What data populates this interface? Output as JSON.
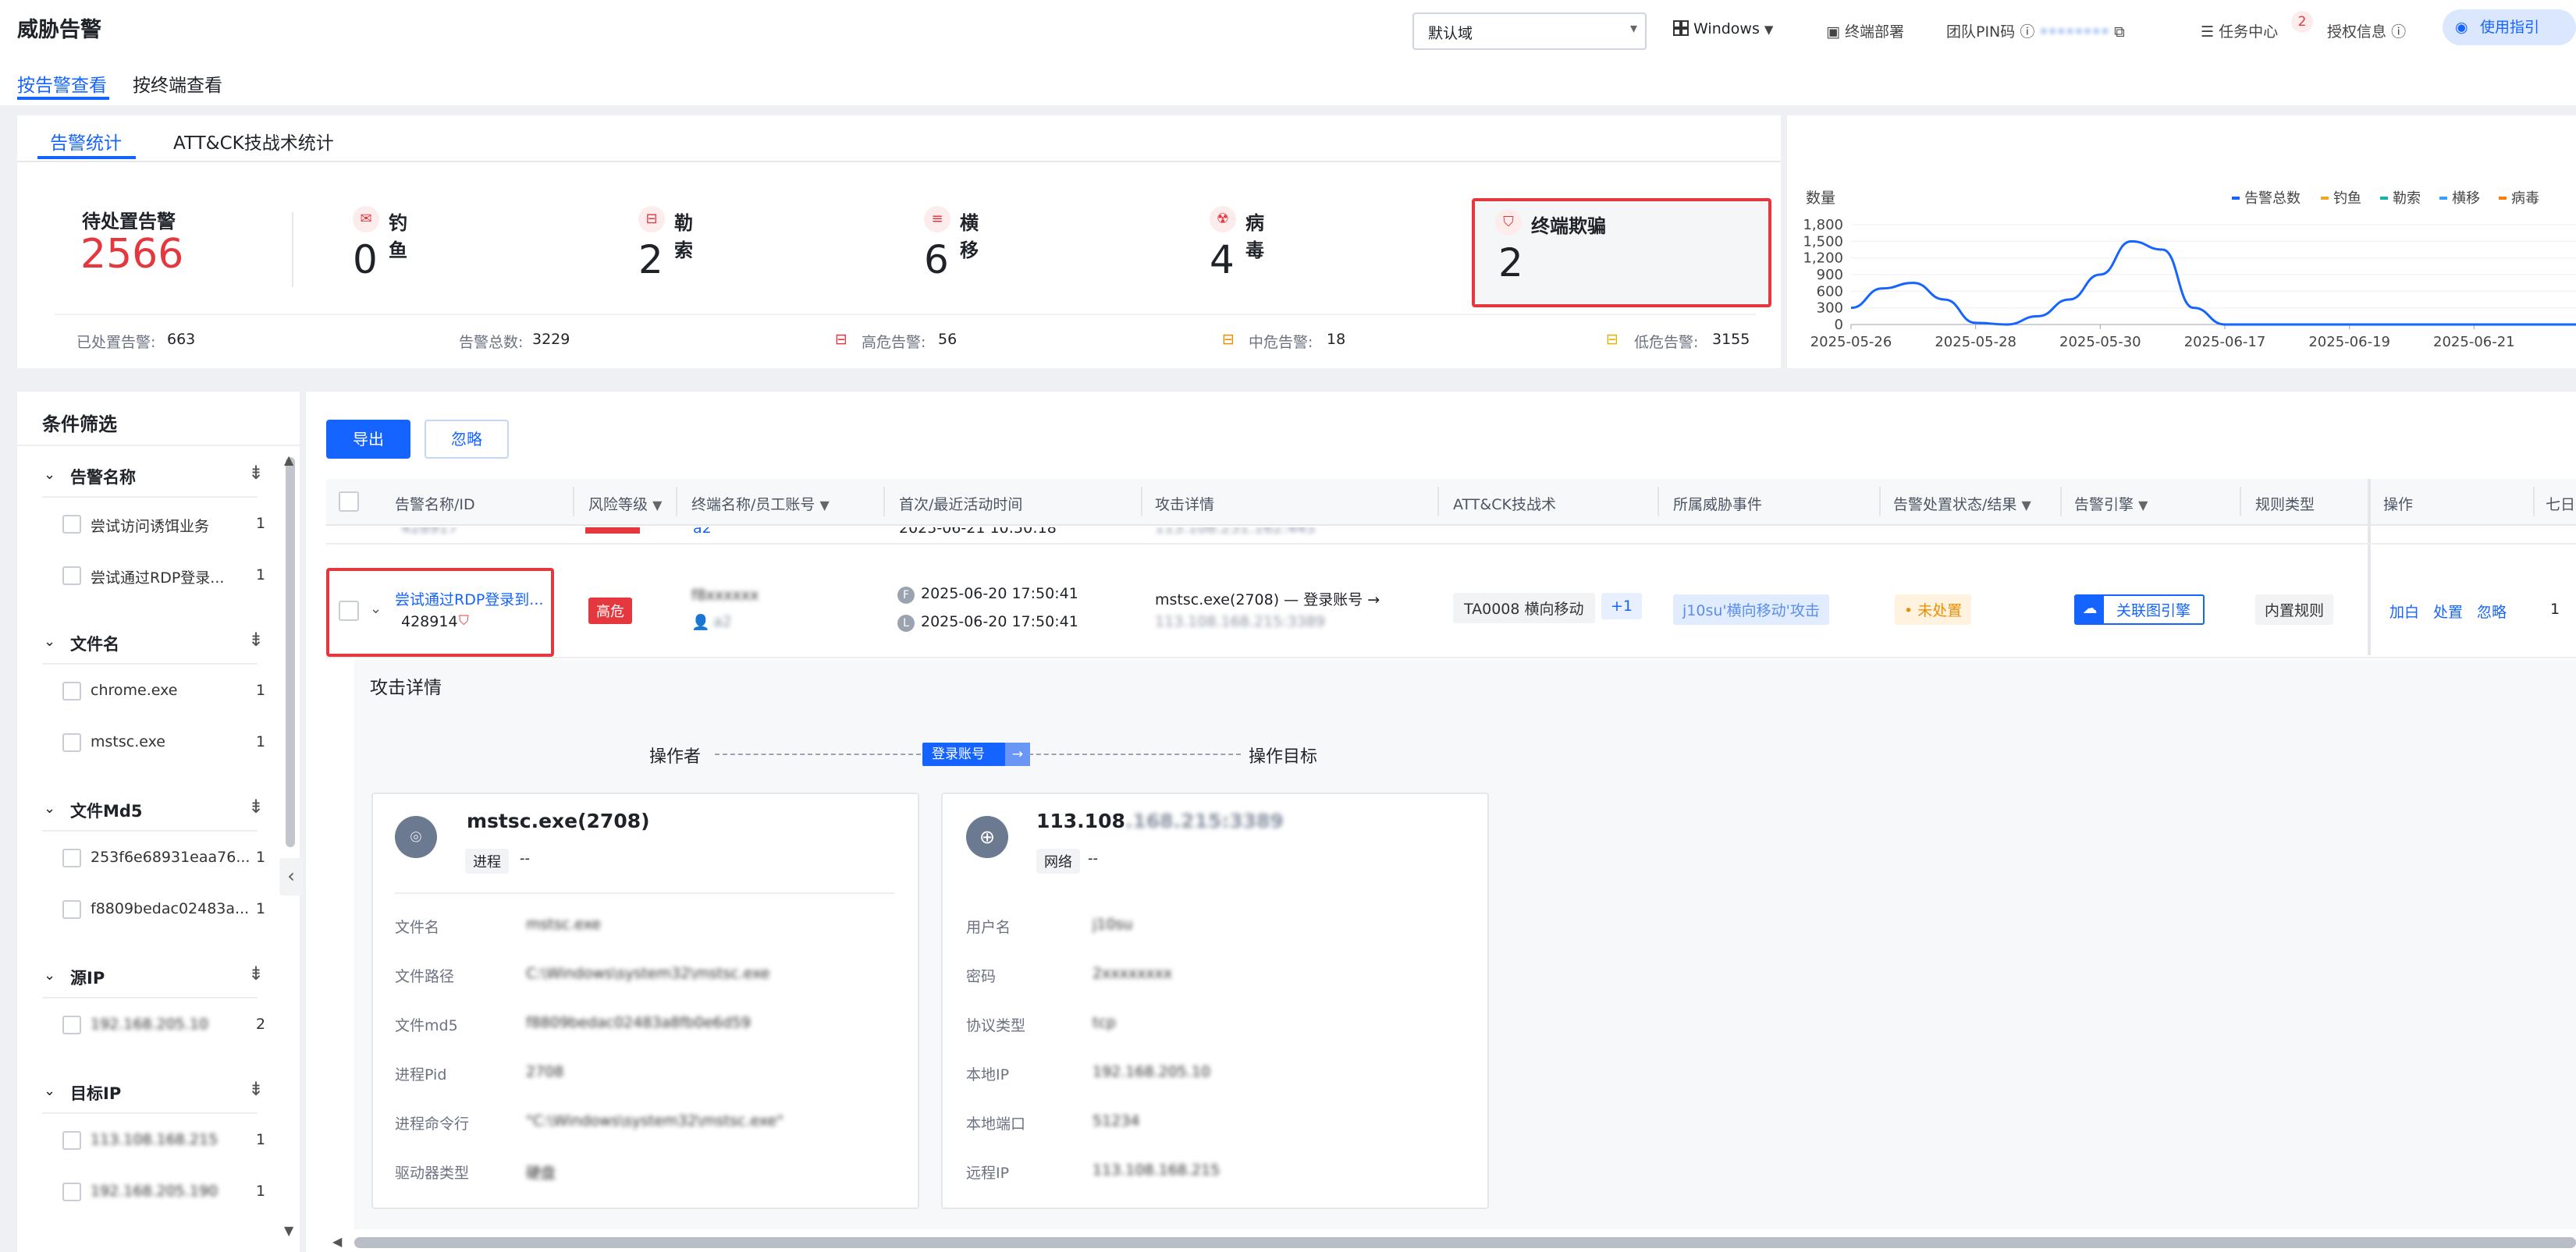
{
  "header": {
    "title": "威胁告警",
    "tabs": [
      "按告警查看",
      "按终端查看"
    ],
    "domain_select": "默认域",
    "os_select": "Windows",
    "deploy": "终端部署",
    "pin_label": "团队PIN码",
    "pin_value": "••••••••",
    "tasks": "任务中心",
    "tasks_badge": "2",
    "license": "授权信息",
    "guide": "使用指引"
  },
  "stats": {
    "tabs": [
      "告警统计",
      "ATT&CK技战术统计"
    ],
    "pending_label": "待处置告警",
    "pending_value": "2566",
    "categories": [
      {
        "label": "钓鱼",
        "value": "0",
        "icon": "fish-icon"
      },
      {
        "label": "勒索",
        "value": "2",
        "icon": "ransom-icon"
      },
      {
        "label": "横移",
        "value": "6",
        "icon": "lateral-icon"
      },
      {
        "label": "病毒",
        "value": "4",
        "icon": "virus-icon"
      },
      {
        "label": "终端欺骗",
        "value": "2",
        "icon": "shield-icon"
      }
    ],
    "footer": {
      "handled_label": "已处置告警:",
      "handled_value": "663",
      "total_label": "告警总数:",
      "total_value": "3229",
      "high_label": "高危告警:",
      "high_value": "56",
      "mid_label": "中危告警:",
      "mid_value": "18",
      "low_label": "低危告警:",
      "low_value": "3155"
    }
  },
  "chart_data": {
    "type": "line",
    "ylabel": "数量",
    "y_ticks": [
      "1,800",
      "1,500",
      "1,200",
      "900",
      "600",
      "300",
      "0"
    ],
    "ylim": [
      0,
      1800
    ],
    "x_ticks": [
      "2025-05-26",
      "2025-05-28",
      "2025-05-30",
      "2025-06-17",
      "2025-06-19",
      "2025-06-21",
      "20"
    ],
    "legend": [
      "告警总数",
      "钓鱼",
      "勒索",
      "横移",
      "病毒"
    ],
    "legend_colors": [
      "#1664ff",
      "#f5a524",
      "#12b3a8",
      "#3aa0ff",
      "#ff7d00"
    ],
    "legend_position": "top",
    "series": [
      {
        "name": "告警总数",
        "points": [
          [
            0,
            300
          ],
          [
            0.5,
            650
          ],
          [
            1,
            750
          ],
          [
            1.5,
            450
          ],
          [
            2,
            30
          ],
          [
            2.5,
            0
          ],
          [
            3,
            150
          ],
          [
            3.5,
            450
          ],
          [
            4,
            900
          ],
          [
            4.5,
            1500
          ],
          [
            5,
            1350
          ],
          [
            5.5,
            300
          ],
          [
            6,
            0
          ],
          [
            7,
            0
          ],
          [
            8,
            0
          ],
          [
            9,
            0
          ],
          [
            10,
            0
          ],
          [
            11,
            0
          ],
          [
            12,
            0
          ]
        ]
      }
    ],
    "x_index_of_ticks": [
      0,
      2,
      4,
      6,
      8,
      10,
      12
    ]
  },
  "actions": {
    "export": "导出",
    "ignore": "忽略"
  },
  "filters": {
    "title": "条件筛选",
    "groups": [
      {
        "name": "告警名称",
        "items": [
          {
            "label": "尝试访问诱饵业务",
            "count": "1"
          },
          {
            "label": "尝试通过RDP登录...",
            "count": "1"
          }
        ]
      },
      {
        "name": "文件名",
        "items": [
          {
            "label": "chrome.exe",
            "count": "1"
          },
          {
            "label": "mstsc.exe",
            "count": "1"
          }
        ]
      },
      {
        "name": "文件Md5",
        "items": [
          {
            "label": "253f6e68931eaa76...",
            "count": "1"
          },
          {
            "label": "f8809bedac02483a...",
            "count": "1"
          }
        ]
      },
      {
        "name": "源IP",
        "items": [
          {
            "label": "192.168.205.10",
            "count": "2"
          }
        ]
      },
      {
        "name": "目标IP",
        "items": [
          {
            "label": "113.108.168.215",
            "count": "1"
          },
          {
            "label": "192.168.205.190",
            "count": "1"
          }
        ]
      }
    ]
  },
  "table": {
    "columns": [
      "告警名称/ID",
      "风险等级",
      "终端名称/员工账号",
      "首次/最近活动时间",
      "攻击详情",
      "ATT&CK技战术",
      "所属威胁事件",
      "告警处置状态/结果",
      "告警引擎",
      "规则类型",
      "操作",
      "七日"
    ],
    "prev_row": {
      "id": "428917",
      "account": "a2",
      "time": "2025-06-21 10:50:18",
      "detail": "113.108.231.162:445"
    },
    "row": {
      "name": "尝试通过RDP登录到...",
      "id": "428914",
      "risk": "高危",
      "endpoint": "f8xxxxxx",
      "account": "a2",
      "first_time": "2025-06-20 17:50:41",
      "last_time": "2025-06-20 17:50:41",
      "first_mark": "F",
      "last_mark": "L",
      "detail_line1": "mstsc.exe(2708) — 登录账号 →",
      "detail_line2": "113.108.168.215:3389",
      "tactic": "TA0008 横向移动",
      "tactic_more": "+1",
      "event": "j10su'横向移动'攻击",
      "status": "• 未处置",
      "engine": "关联图引擎",
      "rule": "内置规则",
      "op_whitelist": "加白",
      "op_handle": "处置",
      "op_ignore": "忽略",
      "seven_day": "1"
    }
  },
  "detail": {
    "title": "攻击详情",
    "operator": "操作者",
    "target": "操作目标",
    "link": "登录账号",
    "left_card": {
      "name": "mstsc.exe(2708)",
      "type": "进程",
      "type_extra": "--",
      "fields": [
        {
          "k": "文件名",
          "v": "mstsc.exe"
        },
        {
          "k": "文件路径",
          "v": "C:\\Windows\\system32\\mstsc.exe"
        },
        {
          "k": "文件md5",
          "v": "f8809bedac02483a8fb0e6d59"
        },
        {
          "k": "进程Pid",
          "v": "2708"
        },
        {
          "k": "进程命令行",
          "v": "\"C:\\Windows\\system32\\mstsc.exe\""
        },
        {
          "k": "驱动器类型",
          "v": "硬盘"
        }
      ]
    },
    "right_card": {
      "name": "113.108.168.215:3389",
      "type": "网络",
      "type_extra": "--",
      "fields": [
        {
          "k": "用户名",
          "v": "j10su"
        },
        {
          "k": "密码",
          "v": "2xxxxxxxx"
        },
        {
          "k": "协议类型",
          "v": "tcp"
        },
        {
          "k": "本地IP",
          "v": "192.168.205.10"
        },
        {
          "k": "本地端口",
          "v": "51234"
        },
        {
          "k": "远程IP",
          "v": "113.108.168.215"
        }
      ]
    }
  }
}
